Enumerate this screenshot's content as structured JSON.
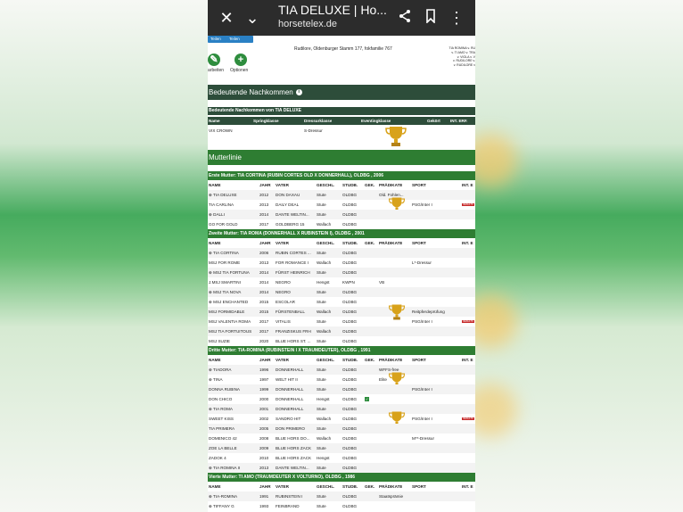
{
  "browser": {
    "title": "TIA DELUXE | Ho...",
    "url": "horsetelex.de"
  },
  "page": {
    "share_labels": [
      "Teilen",
      "Teilen"
    ],
    "actions": [
      {
        "label": "arbeiten",
        "icon": "edit-icon"
      },
      {
        "label": "Optionen",
        "icon": "plus-icon"
      }
    ],
    "pedigree_line": "Rudilore, Oldenburger Stamm 177, fokfamilie 767",
    "pedigree_right": [
      "TIA ROMINA v. RU",
      "v. TI AMO v. TRA",
      "v. VIOLA v. V",
      "v. RUDILORE v.",
      "v. RUDILORE v"
    ],
    "section_offspring_title": "Bedeutende Nachkommen",
    "offspring_table_title": "Bedeutende Nachkommen von TIA DELUXE",
    "offspring_headers": [
      "Name",
      "Springklasse",
      "Dressurklasse",
      "Eventingklasse",
      "Gekört",
      "INT. ERF."
    ],
    "offspring_rows": [
      {
        "name": "VIX CROWN",
        "springklasse": "",
        "dressurklasse": "S-Dressur",
        "eventing": ""
      }
    ],
    "section_mother_title": "Mutterlinie",
    "line_headers": [
      "NAME",
      "JAHR",
      "VATER",
      "GESCHL.",
      "STUDB.",
      "GEK.",
      "PRÄDIKATE",
      "SPORT",
      "INT. E"
    ],
    "mothers": [
      {
        "title": "Erste Mutter: TIA CORTINA (RUBIN CORTES OLD X DONNERHALL), OLDBG , 2006",
        "rows": [
          {
            "name": "⊕ TIA DELUXE",
            "jahr": "2012",
            "vater": "DON DAXAU",
            "geschl": "Stute",
            "studb": "OLDBG",
            "pradikate": "Old. Fohlen...",
            "sport": "",
            "badge": false
          },
          {
            "name": "TIA CARLINA",
            "jahr": "2013",
            "vater": "DAILY DEAL",
            "geschl": "Stute",
            "studb": "OLDBG",
            "pradikate": "",
            "sport": "PSG/Inter I",
            "badge": true
          },
          {
            "name": "⊕ DALLI",
            "jahr": "2014",
            "vater": "DANTE WELTIN...",
            "geschl": "Stute",
            "studb": "OLDBG",
            "pradikate": "",
            "sport": "",
            "badge": false
          },
          {
            "name": "GO FOR GOLD",
            "jahr": "2017",
            "vater": "GOLDBERG 15",
            "geschl": "Wallach",
            "studb": "OLDBG",
            "pradikate": "",
            "sport": "",
            "badge": false
          }
        ]
      },
      {
        "title": "Zweite Mutter: TIA ROMA (DONNERHALL X RUBINSTEIN I), OLDBG , 2001",
        "rows": [
          {
            "name": "⊕ TIA CORTINA",
            "jahr": "2006",
            "vater": "RUBIN CORTES ...",
            "geschl": "Stute",
            "studb": "OLDBG",
            "pradikate": "",
            "sport": "",
            "badge": false
          },
          {
            "name": "MSJ FOR ROME",
            "jahr": "2013",
            "vater": "FOR ROMANCE I",
            "geschl": "Wallach",
            "studb": "OLDBG",
            "pradikate": "",
            "sport": "L*-Dressur",
            "badge": false
          },
          {
            "name": "⊕ MSJ TIA FORTUNA",
            "jahr": "2014",
            "vater": "FÜRST HEINRICH",
            "geschl": "Stute",
            "studb": "OLDBG",
            "pradikate": "",
            "sport": "",
            "badge": false
          },
          {
            "name": "J.MSJ SMARTINI",
            "jahr": "2014",
            "vater": "NEGRO",
            "geschl": "Hengst",
            "studb": "KWPN",
            "pradikate": "VB",
            "sport": "",
            "badge": false
          },
          {
            "name": "⊕ MSJ TIA NOVA",
            "jahr": "2014",
            "vater": "NEGRO",
            "geschl": "Stute",
            "studb": "OLDBG",
            "pradikate": "",
            "sport": "",
            "badge": false
          },
          {
            "name": "⊕ MSJ ENCHANTED",
            "jahr": "2015",
            "vater": "ESCOLAR",
            "geschl": "Stute",
            "studb": "OLDBG",
            "pradikate": "",
            "sport": "",
            "badge": false
          },
          {
            "name": "MSJ FORMIDABLE",
            "jahr": "2015",
            "vater": "FÜRSTENBALL",
            "geschl": "Wallach",
            "studb": "OLDBG",
            "pradikate": "",
            "sport": "Reitpferdeprüfung",
            "badge": false
          },
          {
            "name": "MSJ VALENTIA ROMA",
            "jahr": "2017",
            "vater": "VITALIS",
            "geschl": "Stute",
            "studb": "OLDBG",
            "pradikate": "",
            "sport": "PSG/Inter I",
            "badge": true
          },
          {
            "name": "MSJ TIA FORTUITOUS",
            "jahr": "2017",
            "vater": "FRANZISKUS FRH",
            "geschl": "Wallach",
            "studb": "OLDBG",
            "pradikate": "",
            "sport": "",
            "badge": false
          },
          {
            "name": "MSJ SUZIE",
            "jahr": "2020",
            "vater": "BLUE HORS ST. ...",
            "geschl": "Stute",
            "studb": "OLDBG",
            "pradikate": "",
            "sport": "",
            "badge": false
          }
        ]
      },
      {
        "title": "Dritte Mutter: TIA-ROMINA (RUBINSTEIN I X TRAUMDEUTER), OLDBG , 1991",
        "rows": [
          {
            "name": "⊕ TIADORA",
            "jahr": "1996",
            "vater": "DONNERHALL",
            "geschl": "Stute",
            "studb": "OLDBG",
            "pradikate": "WFFS-free",
            "sport": "",
            "badge": false
          },
          {
            "name": "⊕ TINA",
            "jahr": "1997",
            "vater": "WELT HIT II",
            "geschl": "Stute",
            "studb": "OLDBG",
            "pradikate": "Elite",
            "sport": "",
            "badge": false
          },
          {
            "name": "DONNA RUBINA",
            "jahr": "1999",
            "vater": "DONNERHALL",
            "geschl": "Stute",
            "studb": "OLDBG",
            "pradikate": "",
            "sport": "PSG/Inter I",
            "badge": false
          },
          {
            "name": "DON CHICO",
            "jahr": "2000",
            "vater": "DONNERHALL",
            "geschl": "Hengst",
            "studb": "OLDBG",
            "pradikate": "",
            "sport": "",
            "badge": false,
            "gekort": true
          },
          {
            "name": "⊕ TIA ROMA",
            "jahr": "2001",
            "vater": "DONNERHALL",
            "geschl": "Stute",
            "studb": "OLDBG",
            "pradikate": "",
            "sport": "",
            "badge": false
          },
          {
            "name": "SWEET KISS",
            "jahr": "2002",
            "vater": "SANDRO HIT",
            "geschl": "Wallach",
            "studb": "OLDBG",
            "pradikate": "",
            "sport": "PSG/Inter I",
            "badge": true
          },
          {
            "name": "TIA PRIMERA",
            "jahr": "2005",
            "vater": "DON PRIMERO",
            "geschl": "Stute",
            "studb": "OLDBG",
            "pradikate": "",
            "sport": "",
            "badge": false
          },
          {
            "name": "DOMENICO 42",
            "jahr": "2008",
            "vater": "BLUE HORS DO...",
            "geschl": "Wallach",
            "studb": "OLDBG",
            "pradikate": "",
            "sport": "M**-Dressur",
            "badge": false
          },
          {
            "name": "ZOE LA BELLE",
            "jahr": "2009",
            "vater": "BLUE HORS ZACK",
            "geschl": "Stute",
            "studb": "OLDBG",
            "pradikate": "",
            "sport": "",
            "badge": false
          },
          {
            "name": "ZADOK 4",
            "jahr": "2010",
            "vater": "BLUE HORS ZACK",
            "geschl": "Hengst",
            "studb": "OLDBG",
            "pradikate": "",
            "sport": "",
            "badge": false
          },
          {
            "name": "⊕ TIA ROMINA II",
            "jahr": "2013",
            "vater": "DANTE WELTIN...",
            "geschl": "Stute",
            "studb": "OLDBG",
            "pradikate": "",
            "sport": "",
            "badge": false
          }
        ]
      },
      {
        "title": "Vierte Mutter: TI AMO (TRAUMDEUTER X VOLTURNO), OLDBG , 1986",
        "rows": [
          {
            "name": "⊕ TIA-ROMINA",
            "jahr": "1991",
            "vater": "RUBINSTEIN I",
            "geschl": "Stute",
            "studb": "OLDBG",
            "pradikate": "Staatsprämie",
            "sport": "",
            "badge": false
          },
          {
            "name": "⊕ TIFFANY G",
            "jahr": "1993",
            "vater": "FEINBRAND",
            "geschl": "Stute",
            "studb": "OLDBG",
            "pradikate": "",
            "sport": "",
            "badge": false
          }
        ]
      }
    ],
    "badge_text": "RESULTS"
  },
  "colors": {
    "header_dark": "#2d4d3a",
    "header_green": "#2e7d32",
    "trophy": "#d8a21a"
  }
}
